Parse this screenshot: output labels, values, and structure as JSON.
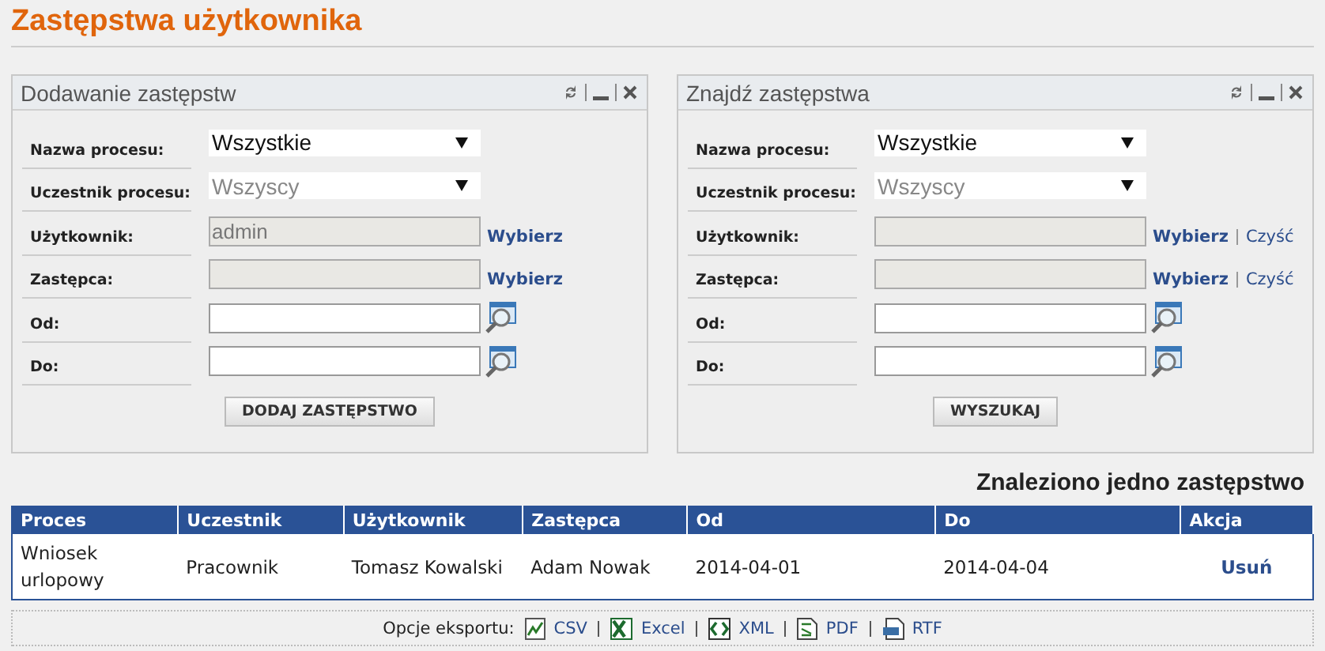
{
  "page_title": "Zastępstwa użytkownika",
  "panels": [
    {
      "title": "Dodawanie zastępstw",
      "button": "DODAJ ZASTĘPSTWO",
      "fields": [
        {
          "label": "Nazwa procesu:",
          "kind": "select",
          "value": "Wszystkie",
          "disabled": false
        },
        {
          "label": "Uczestnik procesu:",
          "kind": "select",
          "value": "Wszyscy",
          "disabled": true
        },
        {
          "label": "Użytkownik:",
          "kind": "picker",
          "value": "admin",
          "links": [
            "Wybierz"
          ]
        },
        {
          "label": "Zastępca:",
          "kind": "picker",
          "links": [
            "Wybierz"
          ]
        },
        {
          "label": "Od:",
          "kind": "date"
        },
        {
          "label": "Do:",
          "kind": "date"
        }
      ]
    },
    {
      "title": "Znajdź zastępstwa",
      "button": "WYSZUKAJ",
      "fields": [
        {
          "label": "Nazwa procesu:",
          "kind": "select",
          "value": "Wszystkie",
          "disabled": false
        },
        {
          "label": "Uczestnik procesu:",
          "kind": "select",
          "value": "Wszyscy",
          "disabled": true
        },
        {
          "label": "Użytkownik:",
          "kind": "picker",
          "links": [
            "Wybierz",
            "Czyść"
          ]
        },
        {
          "label": "Zastępca:",
          "kind": "picker",
          "links": [
            "Wybierz",
            "Czyść"
          ]
        },
        {
          "label": "Od:",
          "kind": "date"
        },
        {
          "label": "Do:",
          "kind": "date"
        }
      ]
    }
  ],
  "result_summary": "Znaleziono jedno zastępstwo",
  "table": {
    "columns": [
      "Proces",
      "Uczestnik",
      "Użytkownik",
      "Zastępca",
      "Od",
      "Do",
      "Akcja"
    ],
    "rows": [
      {
        "cells": [
          "Wniosek urlopowy",
          "Pracownik",
          "Tomasz Kowalski",
          "Adam Nowak",
          "2014-04-01",
          "2014-04-04"
        ],
        "action": "Usuń"
      }
    ]
  },
  "export": {
    "label": "Opcje eksportu:",
    "formats": [
      {
        "label": "CSV",
        "kind": "csv"
      },
      {
        "label": "Excel",
        "kind": "excel"
      },
      {
        "label": "XML",
        "kind": "xml"
      },
      {
        "label": "PDF",
        "kind": "pdf"
      },
      {
        "label": "RTF",
        "kind": "rtf"
      }
    ]
  }
}
